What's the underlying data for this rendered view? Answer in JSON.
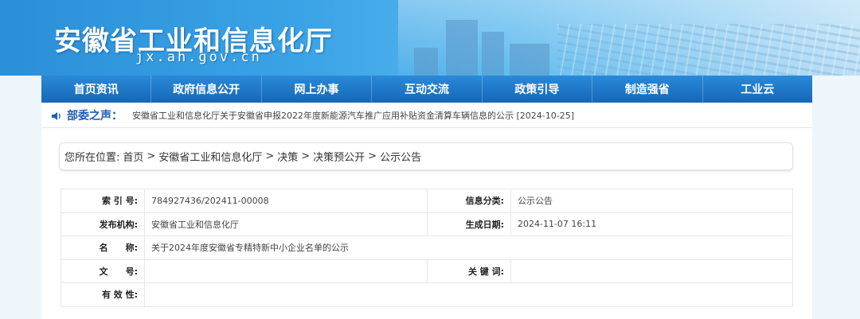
{
  "header": {
    "site_title": "安徽省工业和信息化厅",
    "domain": "jx.ah.gov.cn"
  },
  "nav": {
    "items": [
      "首页资讯",
      "政府信息公开",
      "网上办事",
      "互动交流",
      "政策引导",
      "制造强省",
      "工业云"
    ]
  },
  "ticker": {
    "icon": "speaker-icon",
    "label": "部委之声：",
    "text": "安徽省工业和信息化厅关于安徽省申报2022年度新能源汽车推广应用补贴资金清算车辆信息的公示 [2024-10-25]"
  },
  "breadcrumb": {
    "prefix": "您所在位置:",
    "items": [
      "首页",
      "安徽省工业和信息化厅",
      "决策",
      "决策预公开",
      "公示公告"
    ],
    "separator": ">"
  },
  "info": {
    "index_label": "索 引 号:",
    "index_value": "784927436/202411-00008",
    "category_label": "信息分类:",
    "category_value": "公示公告",
    "publisher_label": "发布机构:",
    "publisher_value": "安徽省工业和信息化厅",
    "date_label": "生成日期:",
    "date_value": "2024-11-07 16:11",
    "name_label": "名　　称:",
    "name_value": "关于2024年度安徽省专精特新中小企业名单的公示",
    "docno_label": "文　　号:",
    "docno_value": "",
    "keywords_label": "关 键 词:",
    "keywords_value": "",
    "validity_label": "有 效 性:",
    "validity_value": ""
  },
  "colors": {
    "nav_bg": "#1667b8",
    "ticker_label": "#1c5fb0",
    "banner": "#3aa3e6"
  }
}
